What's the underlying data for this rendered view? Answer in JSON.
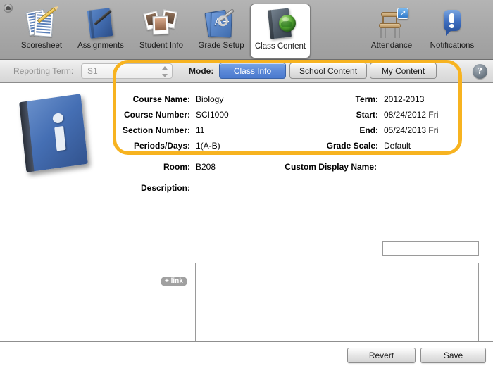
{
  "window": {
    "close_button": "close-button"
  },
  "toolbar": {
    "items": [
      {
        "label": "Scoresheet",
        "icon": "scoresheet-icon",
        "selected": false
      },
      {
        "label": "Assignments",
        "icon": "assignments-icon",
        "selected": false
      },
      {
        "label": "Student Info",
        "icon": "student-info-icon",
        "selected": false
      },
      {
        "label": "Grade Setup",
        "icon": "grade-setup-icon",
        "selected": false
      },
      {
        "label": "Class Content",
        "icon": "class-content-icon",
        "selected": true
      },
      {
        "label": "Attendance",
        "icon": "attendance-icon",
        "selected": false
      },
      {
        "label": "Notifications",
        "icon": "notifications-icon",
        "selected": false
      }
    ],
    "grade_setup_badge": "A+",
    "attendance_badge": "↗",
    "notifications_badge": "!"
  },
  "controlbar": {
    "reporting_term_label": "Reporting Term:",
    "reporting_term_value": "S1",
    "mode_label": "Mode:",
    "modes": [
      {
        "label": "Class Info",
        "active": true
      },
      {
        "label": "School Content",
        "active": false
      },
      {
        "label": "My Content",
        "active": false
      }
    ],
    "help_label": "?"
  },
  "main": {
    "info_icon": "info-book-icon",
    "left_fields": [
      {
        "label": "Course Name:",
        "value": "Biology"
      },
      {
        "label": "Course Number:",
        "value": "SCI1000"
      },
      {
        "label": "Section Number:",
        "value": "11"
      },
      {
        "label": "Periods/Days:",
        "value": "1(A-B)"
      }
    ],
    "right_fields": [
      {
        "label": "Term:",
        "value": "2012-2013"
      },
      {
        "label": "Start:",
        "value": "08/24/2012 Fri"
      },
      {
        "label": "End:",
        "value": "05/24/2013 Fri"
      },
      {
        "label": "Grade Scale:",
        "value": "Default"
      }
    ],
    "room_label": "Room:",
    "room_value": "B208",
    "custom_display_name_label": "Custom Display Name:",
    "custom_display_name_value": "",
    "description_label": "Description:",
    "description_value": "",
    "link_badge_label": "+ link"
  },
  "footer": {
    "revert_label": "Revert",
    "save_label": "Save"
  },
  "colors": {
    "highlight": "#f7b320",
    "accent_blue": "#5d8ad8",
    "toolbar_bg": "#a8a8a8"
  }
}
